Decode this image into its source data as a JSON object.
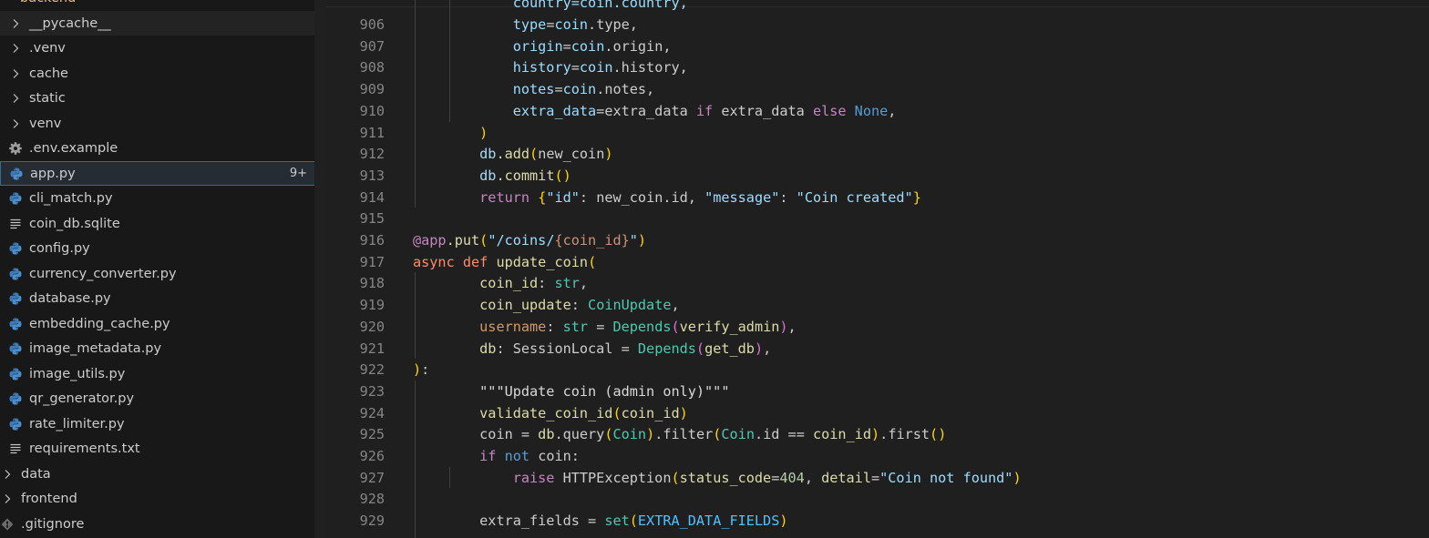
{
  "explorer": {
    "root_label": "backend",
    "items": [
      {
        "label": "__pycache__",
        "kind": "folder",
        "depth": 1,
        "icon": "chevron-right-icon"
      },
      {
        "label": ".venv",
        "kind": "folder",
        "depth": 1,
        "icon": "chevron-right-icon"
      },
      {
        "label": "cache",
        "kind": "folder",
        "depth": 1,
        "icon": "chevron-right-icon"
      },
      {
        "label": "static",
        "kind": "folder",
        "depth": 1,
        "icon": "chevron-right-icon"
      },
      {
        "label": "venv",
        "kind": "folder",
        "depth": 1,
        "icon": "chevron-right-icon"
      },
      {
        "label": ".env.example",
        "kind": "file",
        "depth": 1,
        "icon": "gear-icon"
      },
      {
        "label": "app.py",
        "kind": "file",
        "depth": 1,
        "icon": "python-icon",
        "badge": "9+"
      },
      {
        "label": "cli_match.py",
        "kind": "file",
        "depth": 1,
        "icon": "python-icon"
      },
      {
        "label": "coin_db.sqlite",
        "kind": "file",
        "depth": 1,
        "icon": "text-lines-icon"
      },
      {
        "label": "config.py",
        "kind": "file",
        "depth": 1,
        "icon": "python-icon"
      },
      {
        "label": "currency_converter.py",
        "kind": "file",
        "depth": 1,
        "icon": "python-icon"
      },
      {
        "label": "database.py",
        "kind": "file",
        "depth": 1,
        "icon": "python-icon"
      },
      {
        "label": "embedding_cache.py",
        "kind": "file",
        "depth": 1,
        "icon": "python-icon"
      },
      {
        "label": "image_metadata.py",
        "kind": "file",
        "depth": 1,
        "icon": "python-icon"
      },
      {
        "label": "image_utils.py",
        "kind": "file",
        "depth": 1,
        "icon": "python-icon"
      },
      {
        "label": "qr_generator.py",
        "kind": "file",
        "depth": 1,
        "icon": "python-icon"
      },
      {
        "label": "rate_limiter.py",
        "kind": "file",
        "depth": 1,
        "icon": "python-icon"
      },
      {
        "label": "requirements.txt",
        "kind": "file",
        "depth": 1,
        "icon": "text-lines-icon"
      },
      {
        "label": "data",
        "kind": "folder",
        "depth": 0,
        "icon": "chevron-right-icon"
      },
      {
        "label": "frontend",
        "kind": "folder",
        "depth": 0,
        "icon": "chevron-right-icon"
      },
      {
        "label": ".gitignore",
        "kind": "file",
        "depth": 0,
        "icon": "git-icon"
      }
    ],
    "hovered_item": "__pycache__",
    "selected_item": "app.py"
  },
  "colors": {
    "keyword": "#c586c0",
    "storage": "#ff8c69",
    "builtin": "#569cd6",
    "function": "#dcdcaa",
    "param": "#9cdcfe",
    "string": "#ce9178",
    "docstring": "#d9d9d9",
    "number": "#b5cea8",
    "class": "#4ec9b0",
    "constant": "#4fc1ff",
    "bracket1": "#ffd700",
    "bracket2": "#da70d6",
    "bracket3": "#179fff",
    "plain": "#cccccc",
    "decorator": "#dcdcaa",
    "faded_param": "#d19a66"
  },
  "editor": {
    "partial_top_line": "            country=coin.country,",
    "lines": [
      {
        "n": "906",
        "tokens": [
          [
            "            ",
            "plain"
          ],
          [
            "type",
            "param"
          ],
          [
            "=",
            "plain"
          ],
          [
            "coin",
            "param"
          ],
          [
            ".type,",
            "plain"
          ]
        ]
      },
      {
        "n": "907",
        "tokens": [
          [
            "            ",
            "plain"
          ],
          [
            "origin",
            "param"
          ],
          [
            "=",
            "plain"
          ],
          [
            "coin",
            "param"
          ],
          [
            ".origin,",
            "plain"
          ]
        ]
      },
      {
        "n": "908",
        "tokens": [
          [
            "            ",
            "plain"
          ],
          [
            "history",
            "param"
          ],
          [
            "=",
            "plain"
          ],
          [
            "coin",
            "param"
          ],
          [
            ".history,",
            "plain"
          ]
        ]
      },
      {
        "n": "909",
        "tokens": [
          [
            "            ",
            "plain"
          ],
          [
            "notes",
            "param"
          ],
          [
            "=",
            "plain"
          ],
          [
            "coin",
            "param"
          ],
          [
            ".notes,",
            "plain"
          ]
        ]
      },
      {
        "n": "910",
        "tokens": [
          [
            "            ",
            "plain"
          ],
          [
            "extra_data",
            "param"
          ],
          [
            "=extra_data ",
            "plain"
          ],
          [
            "if",
            "keyword"
          ],
          [
            " extra_data ",
            "plain"
          ],
          [
            "else",
            "keyword"
          ],
          [
            " ",
            "plain"
          ],
          [
            "None",
            "builtin"
          ],
          [
            ",",
            "plain"
          ]
        ]
      },
      {
        "n": "911",
        "tokens": [
          [
            "        ",
            "plain"
          ],
          [
            ")",
            "bracket1"
          ]
        ]
      },
      {
        "n": "912",
        "tokens": [
          [
            "        ",
            "plain"
          ],
          [
            "db",
            "param"
          ],
          [
            ".add",
            "function"
          ],
          [
            "(",
            "bracket1"
          ],
          [
            "new_coin",
            "plain"
          ],
          [
            ")",
            "bracket1"
          ]
        ]
      },
      {
        "n": "913",
        "tokens": [
          [
            "        ",
            "plain"
          ],
          [
            "db",
            "param"
          ],
          [
            ".commit",
            "function"
          ],
          [
            "()",
            "bracket1"
          ]
        ]
      },
      {
        "n": "914",
        "tokens": [
          [
            "        ",
            "plain"
          ],
          [
            "return",
            "keyword"
          ],
          [
            " ",
            "plain"
          ],
          [
            "{",
            "bracket1"
          ],
          [
            "\"id\"",
            "param"
          ],
          [
            ": new_coin.id, ",
            "plain"
          ],
          [
            "\"message\"",
            "param"
          ],
          [
            ": ",
            "plain"
          ],
          [
            "\"Coin created\"",
            "param"
          ],
          [
            "}",
            "bracket1"
          ]
        ]
      },
      {
        "n": "915",
        "tokens": []
      },
      {
        "n": "916",
        "tokens": [
          [
            "@app",
            "keyword"
          ],
          [
            ".put",
            "function"
          ],
          [
            "(",
            "bracket1"
          ],
          [
            "\"/coins/",
            "param"
          ],
          [
            "{coin_id}",
            "string"
          ],
          [
            "\"",
            "param"
          ],
          [
            ")",
            "bracket1"
          ]
        ]
      },
      {
        "n": "917",
        "tokens": [
          [
            "async",
            "storage"
          ],
          [
            " ",
            "plain"
          ],
          [
            "def",
            "storage"
          ],
          [
            " ",
            "plain"
          ],
          [
            "update_coin",
            "function"
          ],
          [
            "(",
            "bracket1"
          ]
        ]
      },
      {
        "n": "918",
        "tokens": [
          [
            "        ",
            "plain"
          ],
          [
            "coin_id",
            "function"
          ],
          [
            ": ",
            "plain"
          ],
          [
            "str",
            "class"
          ],
          [
            ",",
            "plain"
          ]
        ]
      },
      {
        "n": "919",
        "tokens": [
          [
            "        ",
            "plain"
          ],
          [
            "coin_update",
            "function"
          ],
          [
            ": ",
            "plain"
          ],
          [
            "CoinUpdate",
            "class"
          ],
          [
            ",",
            "plain"
          ]
        ]
      },
      {
        "n": "920",
        "tokens": [
          [
            "        ",
            "plain"
          ],
          [
            "username",
            "faded_param"
          ],
          [
            ": ",
            "plain"
          ],
          [
            "str",
            "class"
          ],
          [
            " = ",
            "plain"
          ],
          [
            "Depends",
            "class"
          ],
          [
            "(",
            "bracket2"
          ],
          [
            "verify_admin",
            "function"
          ],
          [
            ")",
            "bracket2"
          ],
          [
            ",",
            "plain"
          ]
        ]
      },
      {
        "n": "921",
        "tokens": [
          [
            "        ",
            "plain"
          ],
          [
            "db",
            "function"
          ],
          [
            ": SessionLocal = ",
            "plain"
          ],
          [
            "Depends",
            "class"
          ],
          [
            "(",
            "bracket2"
          ],
          [
            "get_db",
            "function"
          ],
          [
            ")",
            "bracket2"
          ],
          [
            ",",
            "plain"
          ]
        ]
      },
      {
        "n": "922",
        "tokens": [
          [
            ")",
            "bracket1"
          ],
          [
            ":",
            "plain"
          ]
        ]
      },
      {
        "n": "923",
        "tokens": [
          [
            "        ",
            "plain"
          ],
          [
            "\"\"\"Update coin (admin only)\"\"\"",
            "docstring"
          ]
        ]
      },
      {
        "n": "924",
        "tokens": [
          [
            "        ",
            "plain"
          ],
          [
            "validate_coin_id",
            "function"
          ],
          [
            "(",
            "bracket1"
          ],
          [
            "coin_id",
            "function"
          ],
          [
            ")",
            "bracket1"
          ]
        ]
      },
      {
        "n": "925",
        "tokens": [
          [
            "        ",
            "plain"
          ],
          [
            "coin = ",
            "plain"
          ],
          [
            "db",
            "function"
          ],
          [
            ".query",
            "plain"
          ],
          [
            "(",
            "bracket1"
          ],
          [
            "Coin",
            "class"
          ],
          [
            ")",
            "bracket1"
          ],
          [
            ".filter",
            "plain"
          ],
          [
            "(",
            "bracket1"
          ],
          [
            "Coin",
            "class"
          ],
          [
            ".id == ",
            "plain"
          ],
          [
            "coin_id",
            "function"
          ],
          [
            ")",
            "bracket1"
          ],
          [
            ".first",
            "plain"
          ],
          [
            "()",
            "bracket1"
          ]
        ]
      },
      {
        "n": "926",
        "tokens": [
          [
            "        ",
            "plain"
          ],
          [
            "if",
            "keyword"
          ],
          [
            " ",
            "plain"
          ],
          [
            "not",
            "builtin"
          ],
          [
            " coin:",
            "plain"
          ]
        ]
      },
      {
        "n": "927",
        "tokens": [
          [
            "            ",
            "plain"
          ],
          [
            "raise",
            "keyword"
          ],
          [
            " HTTPException",
            "plain"
          ],
          [
            "(",
            "bracket1"
          ],
          [
            "status_code",
            "function"
          ],
          [
            "=",
            "plain"
          ],
          [
            "404",
            "number"
          ],
          [
            ", ",
            "plain"
          ],
          [
            "detail",
            "function"
          ],
          [
            "=",
            "plain"
          ],
          [
            "\"Coin not found\"",
            "param"
          ],
          [
            ")",
            "bracket1"
          ]
        ]
      },
      {
        "n": "928",
        "tokens": []
      },
      {
        "n": "929",
        "tokens": [
          [
            "        ",
            "plain"
          ],
          [
            "extra_fields = ",
            "plain"
          ],
          [
            "set",
            "class"
          ],
          [
            "(",
            "bracket1"
          ],
          [
            "EXTRA_DATA_FIELDS",
            "constant"
          ],
          [
            ")",
            "bracket1"
          ]
        ]
      }
    ]
  }
}
